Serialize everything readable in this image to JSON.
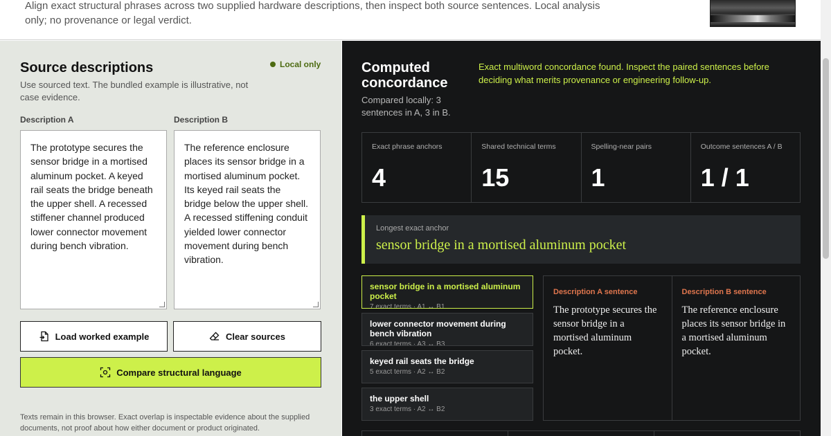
{
  "header": {
    "intro": "Align exact structural phrases across two supplied hardware descriptions, then inspect both source sentences. Local analysis only; no provenance or legal verdict."
  },
  "sources": {
    "title": "Source descriptions",
    "local_badge": "Local only",
    "note": "Use sourced text. The bundled example is illustrative, not case evidence.",
    "a_label": "Description A",
    "b_label": "Description B",
    "a_text": "The prototype secures the sensor bridge in a mortised aluminum pocket. A keyed rail seats the bridge beneath the upper shell. A recessed stiffener channel produced lower connector movement during bench vibration.",
    "b_text": "The reference enclosure places its sensor bridge in a mortised aluminum pocket. Its keyed rail seats the bridge below the upper shell. A recessed stiffening conduit yielded lower connector movement during bench vibration.",
    "load_label": "Load worked example",
    "clear_label": "Clear sources",
    "compare_label": "Compare structural language",
    "footer": "Texts remain in this browser. Exact overlap is inspectable evidence about the supplied documents, not proof about how either document or product originated."
  },
  "results": {
    "title": "Computed concordance",
    "sub": "Compared locally: 3 sentences in A, 3 in B.",
    "finding": "Exact multiword concordance found. Inspect the paired sentences before deciding what merits provenance or engineering follow-up.",
    "stats": [
      {
        "label": "Exact phrase anchors",
        "value": "4"
      },
      {
        "label": "Shared technical terms",
        "value": "15"
      },
      {
        "label": "Spelling-near pairs",
        "value": "1"
      },
      {
        "label": "Outcome sentences A / B",
        "value": "1 / 1"
      }
    ],
    "longest_label": "Longest exact anchor",
    "longest_text": "sensor bridge in a mortised aluminum pocket",
    "matches": [
      {
        "title": "sensor bridge in a mortised aluminum pocket",
        "meta": "7 exact terms · A1 ↔ B1"
      },
      {
        "title": "lower connector movement during bench vibration",
        "meta": "6 exact terms · A3 ↔ B3"
      },
      {
        "title": "keyed rail seats the bridge",
        "meta": "5 exact terms · A2 ↔ B2"
      },
      {
        "title": "the upper shell",
        "meta": "3 exact terms · A2 ↔ B2"
      }
    ],
    "sent_a_label": "Description A sentence",
    "sent_a_text": "The prototype secures the sensor bridge in a mortised aluminum pocket.",
    "sent_b_label": "Description B sentence",
    "sent_b_text": "The reference enclosure places its sensor bridge in a mortised aluminum pocket."
  },
  "colors": {
    "accent": "#cdf04a",
    "panel_dark": "#151617",
    "panel_light": "#e4e7e1",
    "sentence_label": "#e0764e"
  }
}
